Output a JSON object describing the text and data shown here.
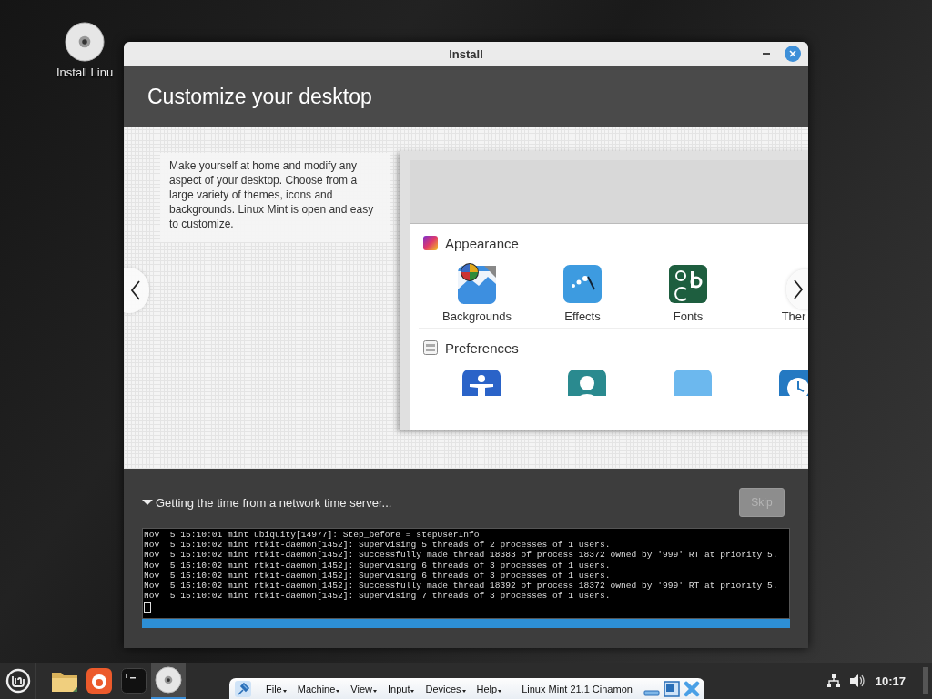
{
  "desktop_icons": [
    {
      "label": "Install Linu",
      "kind": "disc"
    }
  ],
  "window": {
    "title": "Install",
    "controls": [
      {
        "kind": "minimize"
      },
      {
        "kind": "close"
      }
    ]
  },
  "header": {
    "title": "Customize your desktop"
  },
  "slideshow": {
    "description": "Make yourself at home and modify any aspect of your desktop. Choose from a large variety of themes, icons and backgrounds. Linux Mint is open and easy to customize.",
    "screenshot": {
      "sections": [
        {
          "title": "Appearance",
          "kind": "appearance",
          "items": [
            {
              "label": "Backgrounds",
              "kind": "backgrounds"
            },
            {
              "label": "Effects",
              "kind": "effects"
            },
            {
              "label": "Fonts",
              "kind": "fonts"
            },
            {
              "label": "Ther",
              "kind": "themes"
            }
          ]
        },
        {
          "title": "Preferences",
          "kind": "preferences",
          "items": [
            {
              "kind": "accessibility"
            },
            {
              "kind": "account"
            },
            {
              "kind": "blank"
            },
            {
              "kind": "clock"
            }
          ]
        }
      ]
    }
  },
  "progress": {
    "label": "Getting the time from a network time server...",
    "expanded": true,
    "level": 1
  },
  "skip_button": {
    "label": "Skip",
    "disabled": true
  },
  "log": {
    "cursor": true,
    "lines": [
      "Nov  5 15:10:01 mint ubiquity[14977]: Step_before = stepUserInfo",
      "Nov  5 15:10:02 mint rtkit-daemon[1452]: Supervising 5 threads of 2 processes of 1 users.",
      "Nov  5 15:10:02 mint rtkit-daemon[1452]: Successfully made thread 18383 of process 18372 owned by '999' RT at priority 5.",
      "Nov  5 15:10:02 mint rtkit-daemon[1452]: Supervising 6 threads of 3 processes of 1 users.",
      "Nov  5 15:10:02 mint rtkit-daemon[1452]: Supervising 6 threads of 3 processes of 1 users.",
      "Nov  5 15:10:02 mint rtkit-daemon[1452]: Successfully made thread 18392 of process 18372 owned by '999' RT at priority 5.",
      "Nov  5 15:10:02 mint rtkit-daemon[1452]: Supervising 7 threads of 3 processes of 1 users."
    ]
  },
  "taskbar": {
    "launchers": [
      {
        "kind": "folder",
        "active": false
      },
      {
        "kind": "browser",
        "active": false
      },
      {
        "kind": "terminal",
        "active": false
      },
      {
        "kind": "disc",
        "active": true
      }
    ],
    "tray": [
      {
        "kind": "network"
      },
      {
        "kind": "volume"
      }
    ],
    "clock": "10:17"
  },
  "vbox": {
    "menus": [
      "File",
      "Machine",
      "View",
      "Input",
      "Devices",
      "Help"
    ],
    "title": "Linux Mint 21.1 Cinamon"
  }
}
